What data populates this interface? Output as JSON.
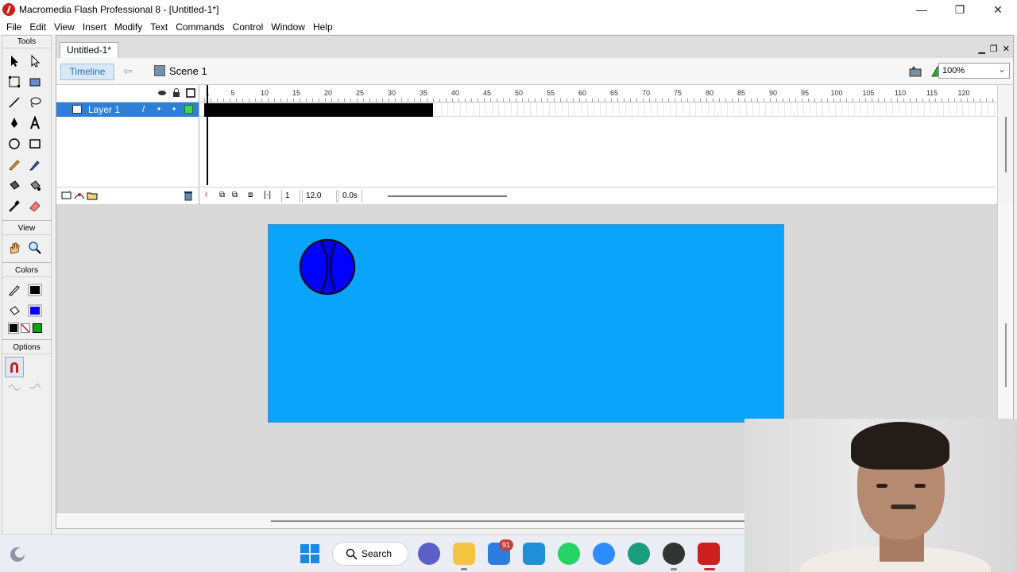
{
  "window": {
    "title": "Macromedia Flash Professional 8 - [Untitled-1*]",
    "controls": [
      "—",
      "❐",
      "✕"
    ]
  },
  "menu": [
    "File",
    "Edit",
    "View",
    "Insert",
    "Modify",
    "Text",
    "Commands",
    "Control",
    "Window",
    "Help"
  ],
  "tools": {
    "title": "Tools",
    "view_title": "View",
    "colors_title": "Colors",
    "options_title": "Options",
    "stroke_color": "#000000",
    "fill_color": "#0000ff"
  },
  "document": {
    "tab": "Untitled-1*",
    "timeline_button": "Timeline",
    "scene": "Scene 1",
    "zoom": "100%"
  },
  "timeline": {
    "layer_name": "Layer 1",
    "ruler_ticks": [
      "1",
      "5",
      "10",
      "15",
      "20",
      "25",
      "30",
      "35",
      "40",
      "45",
      "50",
      "55",
      "60",
      "65",
      "70",
      "75",
      "80",
      "85",
      "90",
      "95",
      "100",
      "105",
      "110",
      "115",
      "120",
      "1"
    ],
    "current_frame": "1",
    "fps": "12.0 fps",
    "elapsed": "0.0s"
  },
  "stage": {
    "background": "#0aa5fb",
    "ball_color": "#0000ff"
  },
  "taskbar": {
    "search_label": "Search",
    "mail_badge": "91"
  }
}
